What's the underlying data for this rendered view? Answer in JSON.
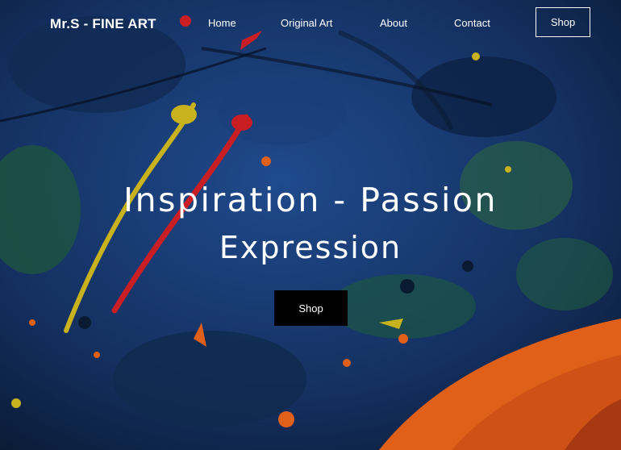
{
  "brand": {
    "name": "Mr.S - FINE ART"
  },
  "nav": {
    "links": [
      "Home",
      "Original Art",
      "About",
      "Contact"
    ],
    "shop_label": "Shop"
  },
  "hero": {
    "headline_line1": "Inspiration - Passion",
    "headline_line2": "Expression",
    "cta_label": "Shop",
    "background": "abstract-painting"
  },
  "colors": {
    "background": "#0d1f3a",
    "text": "#ffffff",
    "cta_background": "#000000",
    "paint_yellow": "#c8b21e",
    "paint_red": "#c81e24",
    "paint_orange": "#e0601a"
  }
}
